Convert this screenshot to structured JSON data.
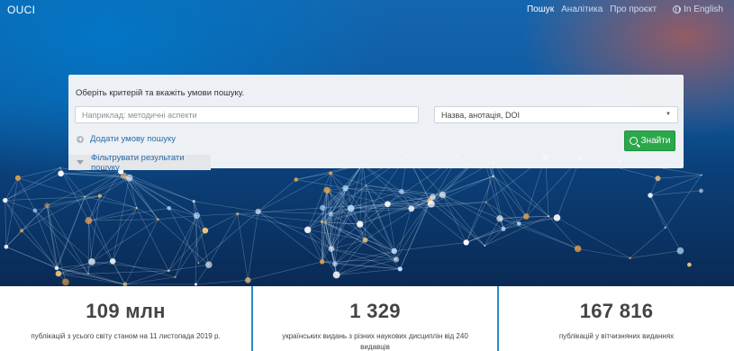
{
  "header": {
    "logo": "OUCI",
    "nav": [
      {
        "label": "Пошук",
        "active": true
      },
      {
        "label": "Аналітика",
        "active": false
      },
      {
        "label": "Про проєкт",
        "active": false
      }
    ],
    "language": "In English"
  },
  "search": {
    "title": "Оберіть критерій та вкажіть умови пошуку.",
    "placeholder": "Наприклад: методичні аспекти",
    "field_selected": "Назва, анотація, DOI",
    "add_condition": "Додати умову пошуку",
    "submit": "Знайти",
    "filter": "Фільтрувати результати пошуку"
  },
  "stats": [
    {
      "value": "109 млн",
      "description": "публікацій з усього світу станом на 11 листопада 2019 р."
    },
    {
      "value": "1 329",
      "description": "українських видань з різних наукових дисциплін від 240 видавців"
    },
    {
      "value": "167 816",
      "description": "публікацій у вітчизняних виданнях"
    }
  ],
  "colors": {
    "accent_green": "#2aa84a",
    "link_blue": "#2a6aa8",
    "divider_blue": "#2b8bc4"
  }
}
